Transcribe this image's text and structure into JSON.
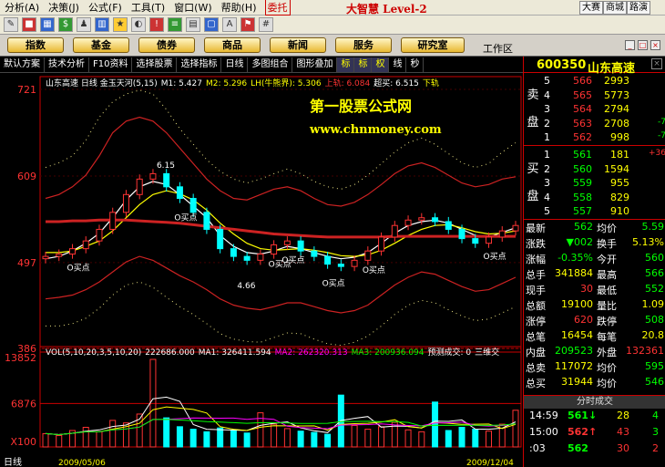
{
  "menu": {
    "items": [
      "分析(A)",
      "决策(J)",
      "公式(F)",
      "工具(T)",
      "窗口(W)",
      "帮助(H)"
    ],
    "delegate": "委托",
    "logo": "大智慧 Level-2",
    "right_buttons": [
      "大赛",
      "商城",
      "路演"
    ]
  },
  "nav": {
    "buttons": [
      "指数",
      "基金",
      "债券",
      "商品",
      "新闻",
      "服务",
      "研究室"
    ],
    "workzone": "工作区"
  },
  "subbar": {
    "items": [
      "默认方案",
      "技术分析",
      "F10资料",
      "选择股票",
      "选择指标",
      "日线",
      "多图组合",
      "图形叠加"
    ],
    "mini": [
      "标",
      "标",
      "权",
      "线",
      "秒"
    ]
  },
  "chart_data": [
    {
      "type": "line",
      "title": "山东高速 日线 金玉天河(5,15)",
      "legend": [
        "M1: 5.427",
        "M2: 5.296",
        "LH(牛熊界): 5.306",
        "上轨: 6.084",
        "超买: 6.515",
        "下轨"
      ],
      "y_ticks": [
        "721",
        "609",
        "497",
        "386"
      ],
      "annotations": [
        "6.15",
        "4.66",
        "O买点",
        "O买点",
        "O买点",
        "O买点",
        "O买点",
        "O买点",
        "O买点"
      ],
      "watermark": [
        "第一股票公式网",
        "www.chnmoney.com"
      ],
      "series": [
        {
          "name": "M1",
          "values": [
            5.02,
            5.05,
            5.12,
            5.22,
            5.35,
            5.55,
            5.78,
            5.95,
            6.02,
            5.98,
            5.85,
            5.7,
            5.55,
            5.32,
            5.18,
            5.1,
            5.08,
            5.12,
            5.18,
            5.15,
            5.1,
            5.05,
            5.02,
            5.04,
            5.1,
            5.22,
            5.35,
            5.45,
            5.5,
            5.52,
            5.48,
            5.4,
            5.32,
            5.3,
            5.36,
            5.42
          ]
        },
        {
          "name": "M2",
          "values": [
            5.1,
            5.1,
            5.12,
            5.18,
            5.25,
            5.38,
            5.55,
            5.72,
            5.85,
            5.9,
            5.86,
            5.78,
            5.65,
            5.48,
            5.34,
            5.22,
            5.15,
            5.13,
            5.14,
            5.15,
            5.13,
            5.1,
            5.06,
            5.05,
            5.07,
            5.13,
            5.22,
            5.32,
            5.4,
            5.45,
            5.46,
            5.42,
            5.37,
            5.34,
            5.35,
            5.38
          ]
        },
        {
          "name": "LH(牛熊界)",
          "values": [
            5.5,
            5.5,
            5.51,
            5.51,
            5.52,
            5.52,
            5.52,
            5.51,
            5.5,
            5.49,
            5.48,
            5.46,
            5.44,
            5.42,
            5.4,
            5.38,
            5.36,
            5.34,
            5.33,
            5.32,
            5.31,
            5.3,
            5.3,
            5.3,
            5.3,
            5.3,
            5.31,
            5.31,
            5.31,
            5.31,
            5.31,
            5.31,
            5.31,
            5.31,
            5.31,
            5.31
          ]
        },
        {
          "name": "上轨",
          "values": [
            5.8,
            5.85,
            5.95,
            6.1,
            6.35,
            6.65,
            6.8,
            6.85,
            6.8,
            6.65,
            6.45,
            6.25,
            6.05,
            5.9,
            5.8,
            5.78,
            5.85,
            5.92,
            5.95,
            5.9,
            5.8,
            5.72,
            5.7,
            5.75,
            5.85,
            5.98,
            6.12,
            6.22,
            6.26,
            6.2,
            6.1,
            6.0,
            5.95,
            5.98,
            6.05,
            6.08
          ]
        },
        {
          "name": "超买",
          "values": [
            6.2,
            6.26,
            6.35,
            6.55,
            6.85,
            7.05,
            7.15,
            7.2,
            7.15,
            6.95,
            6.7,
            6.5,
            6.3,
            6.15,
            6.05,
            6.0,
            6.05,
            6.12,
            6.18,
            6.12,
            6.02,
            5.95,
            5.92,
            5.98,
            6.1,
            6.25,
            6.4,
            6.52,
            6.58,
            6.5,
            6.38,
            6.26,
            6.2,
            6.25,
            6.4,
            6.52
          ]
        },
        {
          "name": "下轨",
          "values": [
            4.5,
            4.52,
            4.55,
            4.62,
            4.72,
            4.85,
            4.98,
            5.05,
            5.0,
            4.9,
            4.8,
            4.72,
            4.62,
            4.5,
            4.42,
            4.38,
            4.36,
            4.4,
            4.45,
            4.45,
            4.4,
            4.35,
            4.32,
            4.35,
            4.42,
            4.55,
            4.68,
            4.78,
            4.85,
            4.82,
            4.74,
            4.66,
            4.6,
            4.62,
            4.7,
            4.78
          ]
        },
        {
          "name": "超卖",
          "values": [
            4.15,
            4.15,
            4.18,
            4.25,
            4.38,
            4.55,
            4.68,
            4.72,
            4.65,
            4.52,
            4.4,
            4.3,
            4.18,
            4.05,
            3.98,
            3.95,
            3.94,
            4.0,
            4.06,
            4.05,
            3.98,
            3.92,
            3.9,
            3.94,
            4.02,
            4.15,
            4.3,
            4.42,
            4.48,
            4.45,
            4.36,
            4.28,
            4.22,
            4.24,
            4.32,
            4.4
          ]
        }
      ],
      "candles_close": [
        5.05,
        5.08,
        5.15,
        5.25,
        5.4,
        5.62,
        5.85,
        6.05,
        6.12,
        5.95,
        5.8,
        5.62,
        5.4,
        5.15,
        5.05,
        5.0,
        5.08,
        5.2,
        5.25,
        5.12,
        5.05,
        4.95,
        4.92,
        5.0,
        5.12,
        5.3,
        5.45,
        5.52,
        5.55,
        5.5,
        5.4,
        5.28,
        5.22,
        5.3,
        5.38,
        5.45
      ],
      "ylim": [
        3.86,
        7.21
      ]
    },
    {
      "type": "bar",
      "title": "VOL(5,10,20,3,5,10,20)",
      "legend": [
        "222686.000",
        "MA1: 326411.594",
        "MA2: 262320.313",
        "MA3: 200936.094",
        "预测成交: 0",
        "三维交"
      ],
      "y_ticks": [
        "13852",
        "6876",
        "X100"
      ],
      "values": [
        2100,
        1800,
        2600,
        3100,
        2400,
        4200,
        3800,
        5200,
        13852,
        4600,
        3200,
        2800,
        2400,
        3000,
        2600,
        2200,
        5400,
        3600,
        2900,
        2500,
        2300,
        2000,
        8200,
        3400,
        2800,
        3200,
        3900,
        2700,
        2400,
        7100,
        2600,
        3100,
        2800,
        2500,
        3600,
        5800
      ],
      "dates": [
        "2009/05/06",
        "2009/12/04"
      ]
    }
  ],
  "sidebar": {
    "code": "600350",
    "name": "山东高速",
    "sell_label": [
      "卖",
      "盘"
    ],
    "buy_label": [
      "买",
      "盘"
    ],
    "asks": [
      {
        "level": "5",
        "price": "566",
        "vol": "2993",
        "chg": ""
      },
      {
        "level": "4",
        "price": "565",
        "vol": "5773",
        "chg": ""
      },
      {
        "level": "3",
        "price": "564",
        "vol": "2794",
        "chg": ""
      },
      {
        "level": "2",
        "price": "563",
        "vol": "2708",
        "chg": "-7"
      },
      {
        "level": "1",
        "price": "562",
        "vol": "998",
        "chg": "-7"
      }
    ],
    "bids": [
      {
        "level": "1",
        "price": "561",
        "vol": "181",
        "chg": "+36"
      },
      {
        "level": "2",
        "price": "560",
        "vol": "1594",
        "chg": ""
      },
      {
        "level": "3",
        "price": "559",
        "vol": "955",
        "chg": ""
      },
      {
        "level": "4",
        "price": "558",
        "vol": "829",
        "chg": ""
      },
      {
        "level": "5",
        "price": "557",
        "vol": "910",
        "chg": ""
      }
    ],
    "quote": [
      {
        "l1": "最新",
        "v1": "562",
        "l2": "均价",
        "v2": "5.59",
        "c1": "#00ff00",
        "c2": "#00ff00"
      },
      {
        "l1": "涨跌",
        "v1": "▼002",
        "l2": "换手",
        "v2": "5.13%",
        "c1": "#00ff00",
        "c2": "#ffff00"
      },
      {
        "l1": "涨幅",
        "v1": "-0.35%",
        "l2": "今开",
        "v2": "560",
        "c1": "#00ff00",
        "c2": "#00ff00"
      },
      {
        "l1": "总手",
        "v1": "341884",
        "l2": "最高",
        "v2": "566",
        "c1": "#ffff00",
        "c2": "#00ff00"
      },
      {
        "l1": "现手",
        "v1": "30",
        "l2": "最低",
        "v2": "552",
        "c1": "#ff3333",
        "c2": "#00ff00"
      },
      {
        "l1": "总额",
        "v1": "19100",
        "l2": "量比",
        "v2": "1.09",
        "c1": "#ffff00",
        "c2": "#ffff00"
      },
      {
        "l1": "涨停",
        "v1": "620",
        "l2": "跌停",
        "v2": "508",
        "c1": "#ff3333",
        "c2": "#00ff00"
      },
      {
        "l1": "总笔",
        "v1": "16454",
        "l2": "每笔",
        "v2": "20.8",
        "c1": "#ffff00",
        "c2": "#ffff00"
      },
      {
        "l1": "内盘",
        "v1": "209523",
        "l2": "外盘",
        "v2": "132361",
        "c1": "#00ff00",
        "c2": "#ff3333"
      },
      {
        "l1": "总卖",
        "v1": "117072",
        "l2": "均价",
        "v2": "595",
        "c1": "#ffff00",
        "c2": "#00ff00"
      },
      {
        "l1": "总买",
        "v1": "31944",
        "l2": "均价",
        "v2": "546",
        "c1": "#ffff00",
        "c2": "#00ff00"
      }
    ],
    "ticks_header": "分时成交",
    "ticks": [
      {
        "time": "14:59",
        "price": "561",
        "arrow": "↓",
        "vol": "28",
        "n": "4",
        "pc": "#00ff00",
        "vc": "#ffff00",
        "nc": "#00ff00"
      },
      {
        "time": "15:00",
        "price": "562",
        "arrow": "↑",
        "vol": "43",
        "n": "3",
        "pc": "#ff3333",
        "vc": "#ff3333",
        "nc": "#00ff00"
      },
      {
        "time": ":03",
        "price": "562",
        "arrow": "",
        "vol": "30",
        "n": "2",
        "pc": "#00ff00",
        "vc": "#ff3333",
        "nc": "#ff3333"
      }
    ]
  },
  "bottom": {
    "tab": "日线"
  }
}
